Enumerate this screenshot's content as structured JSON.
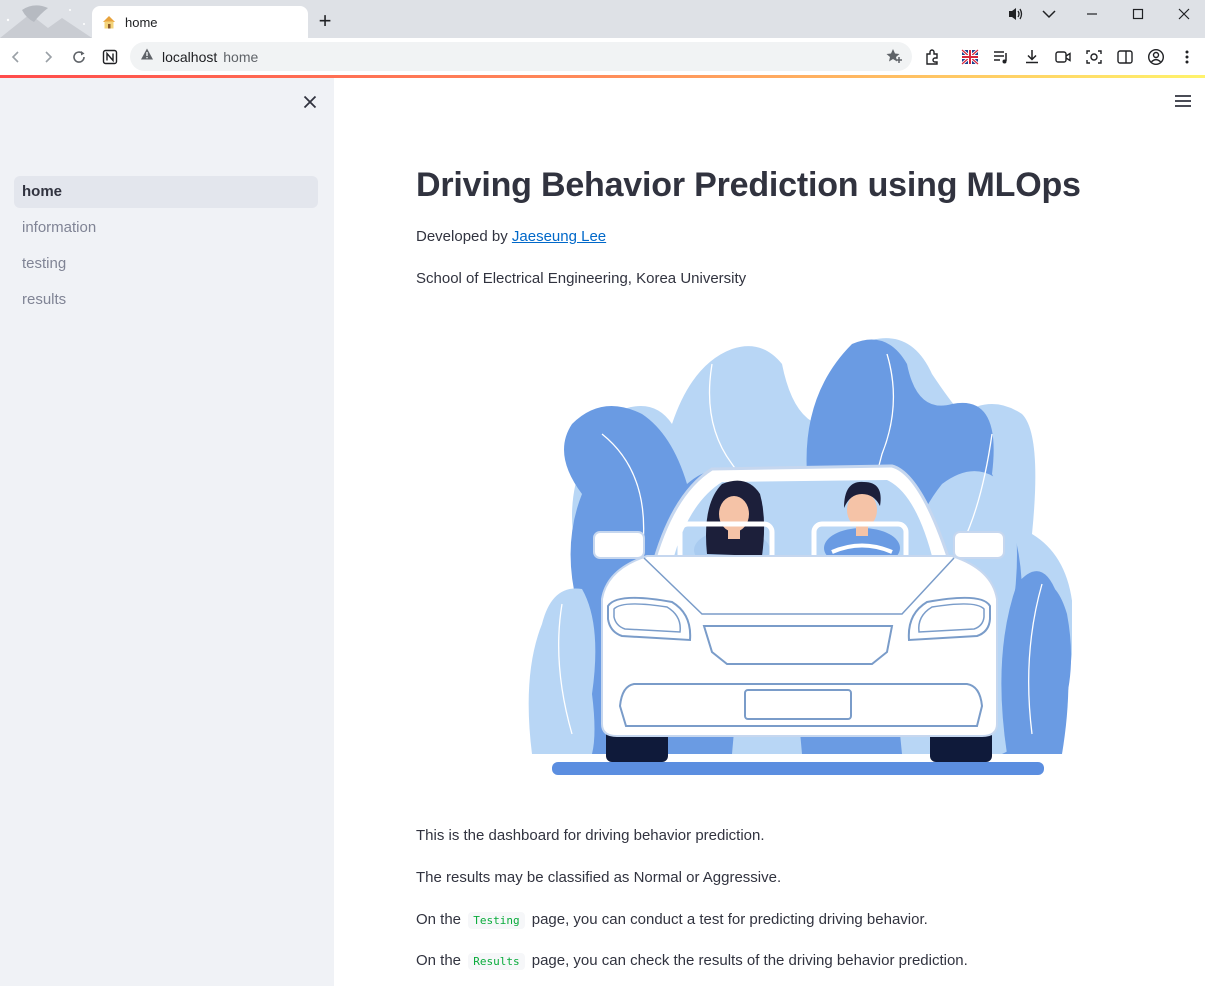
{
  "browser": {
    "tab_title": "home",
    "url_host": "localhost",
    "url_path": "home"
  },
  "sidebar": {
    "items": [
      {
        "label": "home",
        "active": true
      },
      {
        "label": "information",
        "active": false
      },
      {
        "label": "testing",
        "active": false
      },
      {
        "label": "results",
        "active": false
      }
    ]
  },
  "main": {
    "title": "Driving Behavior Prediction using MLOps",
    "developed_prefix": "Developed by ",
    "developer_name": "Jaeseung Lee",
    "affiliation": "School of Electrical Engineering, Korea University",
    "para1": "This is the dashboard for driving behavior prediction.",
    "para2": "The results may be classified as Normal or Aggressive.",
    "para3_prefix": "On the ",
    "para3_code": "Testing",
    "para3_suffix": " page, you can conduct a test for predicting driving behavior.",
    "para4_prefix": "On the ",
    "para4_code": "Results",
    "para4_suffix": " page, you can check the results of the driving behavior prediction."
  },
  "colors": {
    "sidebar_bg": "#f0f2f6",
    "link": "#0068c9",
    "code_text": "#09ab3b",
    "illus_dark_blue": "#6a9be3",
    "illus_light_blue": "#b8d6f5"
  }
}
